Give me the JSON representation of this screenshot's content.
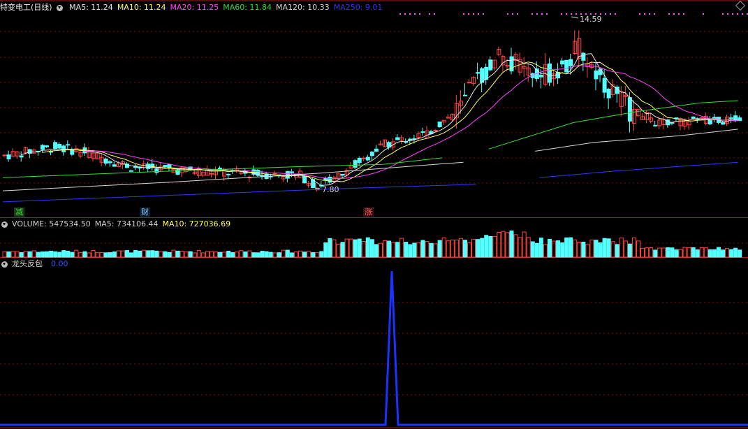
{
  "main_panel": {
    "stock_title": "特变电工(日线)",
    "ma_labels": [
      {
        "text": "MA5: 11.24",
        "color": "#e8e8e8"
      },
      {
        "text": "MA10: 11.24",
        "color": "#ffff66"
      },
      {
        "text": "MA20: 11.25",
        "color": "#ff44ff"
      },
      {
        "text": "MA60: 11.84",
        "color": "#33dd33"
      },
      {
        "text": "MA120: 10.33",
        "color": "#d8d8d8"
      },
      {
        "text": "MA250: 9.01",
        "color": "#3333ff"
      }
    ],
    "high_label": "14.59",
    "low_label": "7.80",
    "tags": [
      {
        "text": "减",
        "color": "#33dd33",
        "bg": "#1b3a1b"
      },
      {
        "text": "财",
        "color": "#88ccff",
        "bg": "#0b1f33"
      },
      {
        "text": "涨",
        "color": "#ff6666",
        "bg": "#3a1010"
      }
    ]
  },
  "volume_panel": {
    "labels": [
      {
        "text": "VOLUME: 547534.50",
        "color": "#d0d0d0"
      },
      {
        "text": "MA5: 734106.44",
        "color": "#d0d0d0"
      },
      {
        "text": "MA10: 727036.69",
        "color": "#ffff66"
      }
    ]
  },
  "indicator_panel": {
    "name": "龙头反包",
    "value": "0.00",
    "value_color": "#3355ff"
  },
  "colors": {
    "up_candle": "#ff4444",
    "down_candle": "#54ffff",
    "grid": "#7a1010",
    "signal_line": "#1a33ff"
  }
}
